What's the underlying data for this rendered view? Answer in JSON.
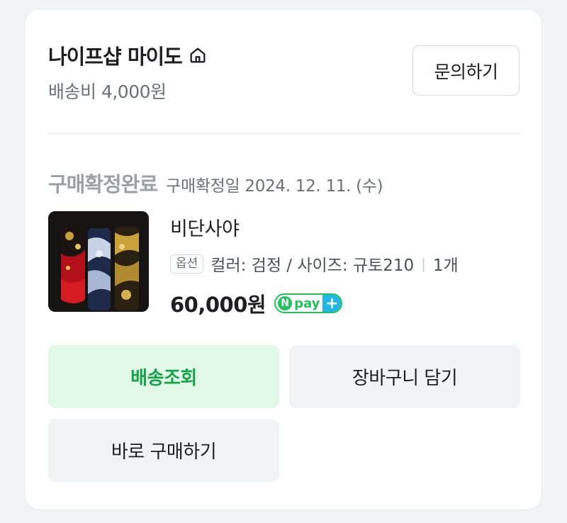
{
  "store": {
    "name": "나이프샵 마이도",
    "shipping_fee": "배송비 4,000원"
  },
  "inquiry_button": "문의하기",
  "order": {
    "status": "구매확정완료",
    "confirm_date": "구매확정일 2024. 12. 11. (수)"
  },
  "product": {
    "name": "비단사야",
    "option_tag": "옵션",
    "option_text": "컬러: 검정 / 사이즈: 규토210",
    "quantity": "1개",
    "price": "60,000원"
  },
  "npay": {
    "n": "N",
    "label": "pay",
    "plus": "+"
  },
  "actions": {
    "track": "배송조회",
    "cart": "장바구니 담기",
    "buy_now": "바로 구매하기"
  },
  "colors": {
    "accent_green": "#16a34a",
    "npay_green": "#20c35a",
    "npay_blue": "#1fb8e8"
  }
}
